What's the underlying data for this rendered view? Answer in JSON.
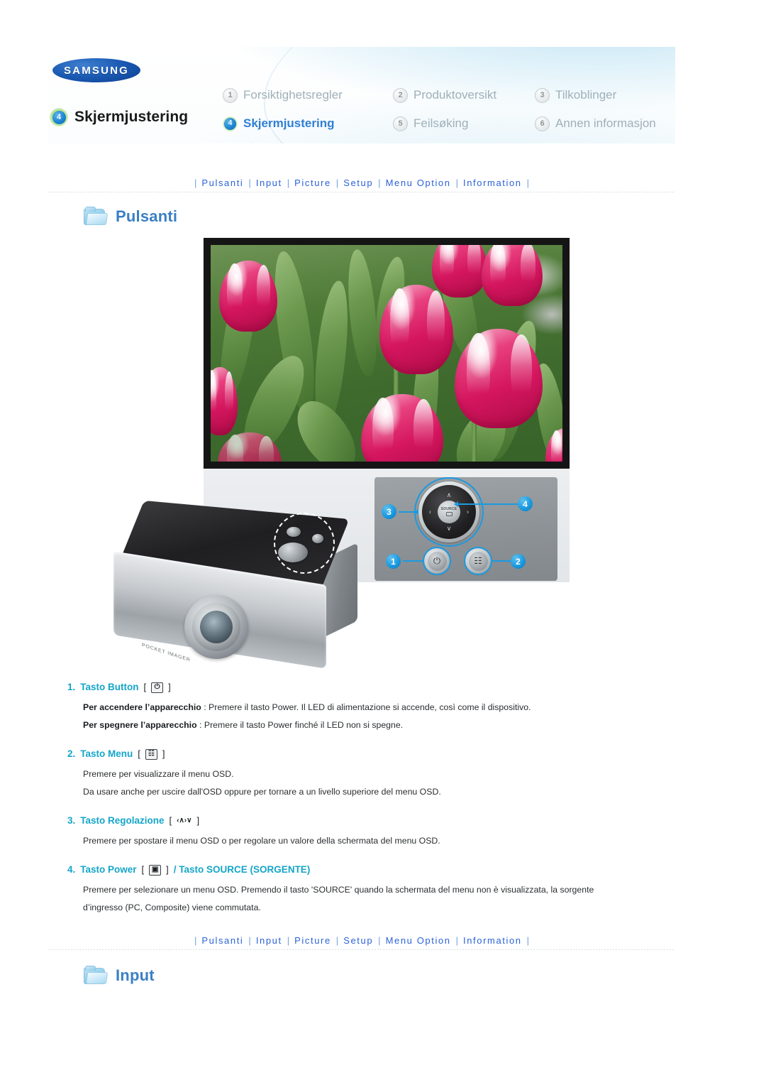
{
  "brand": {
    "logo_text": "SAMSUNG"
  },
  "header": {
    "active_section": {
      "number": "4",
      "label": "Skjermjustering"
    },
    "tabs": [
      {
        "number": "1",
        "label": "Forsiktighetsregler",
        "active": false
      },
      {
        "number": "2",
        "label": "Produktoversikt",
        "active": false
      },
      {
        "number": "3",
        "label": "Tilkoblinger",
        "active": false
      },
      {
        "number": "4",
        "label": "Skjermjustering",
        "active": true
      },
      {
        "number": "5",
        "label": "Feilsøking",
        "active": false
      },
      {
        "number": "6",
        "label": "Annen informasjon",
        "active": false
      }
    ]
  },
  "nav": {
    "separator": "|",
    "links": [
      "Pulsanti",
      "Input",
      "Picture",
      "Setup",
      "Menu Option",
      "Information"
    ]
  },
  "sections": {
    "pulsanti": {
      "title": "Pulsanti",
      "icon": "folder-icon"
    },
    "input": {
      "title": "Input",
      "icon": "folder-icon"
    }
  },
  "diagram": {
    "center_button_label": "SOURCE",
    "callouts": [
      "1",
      "2",
      "3",
      "4"
    ],
    "arrows": {
      "up": "∧",
      "down": "∨",
      "left": "‹",
      "right": "›"
    },
    "power_glyph": "⏻",
    "menu_glyph": "☷"
  },
  "items": [
    {
      "number": "1.",
      "title": "Tasto Button",
      "icon": "power-icon",
      "icon_glyph": "⏻",
      "lines": [
        {
          "bold": "Per accendere l’apparecchio",
          "text": " : Premere il tasto Power. Il LED di alimentazione si accende, così come il dispositivo."
        },
        {
          "bold": "Per spegnere l’apparecchio",
          "text": " : Premere il tasto Power finché il LED non si spegne."
        }
      ]
    },
    {
      "number": "2.",
      "title": "Tasto Menu",
      "icon": "menu-icon",
      "icon_glyph": "☷",
      "lines": [
        {
          "bold": "",
          "text": "Premere per visualizzare il menu OSD."
        },
        {
          "bold": "",
          "text": "Da usare anche per uscire dall'OSD oppure per tornare a un livello superiore del menu OSD."
        }
      ]
    },
    {
      "number": "3.",
      "title": "Tasto Regolazione",
      "icon": "direction-arrows-icon",
      "icon_glyph": "‹∧›∨",
      "lines": [
        {
          "bold": "",
          "text": "Premere per spostare il menu OSD o per regolare un valore della schermata del menu OSD."
        }
      ]
    },
    {
      "number": "4.",
      "title": "Tasto Power",
      "title_suffix": "/ Tasto SOURCE (SORGENTE)",
      "icon": "source-icon",
      "icon_glyph": "▣",
      "lines": [
        {
          "bold": "",
          "text": "Premere per selezionare un menu OSD. Premendo il tasto 'SOURCE' quando la schermata del menu non è visualizzata, la sorgente"
        },
        {
          "bold": "",
          "text": "d’ingresso (PC, Composite) viene commutata."
        }
      ]
    }
  ],
  "colors": {
    "accent_blue": "#2b62d8",
    "heading_cyan": "#14a5c8",
    "section_blue": "#3b7fc4",
    "callout_blue": "#1b9ae0",
    "samsung_blue": "#1c5cb4"
  }
}
